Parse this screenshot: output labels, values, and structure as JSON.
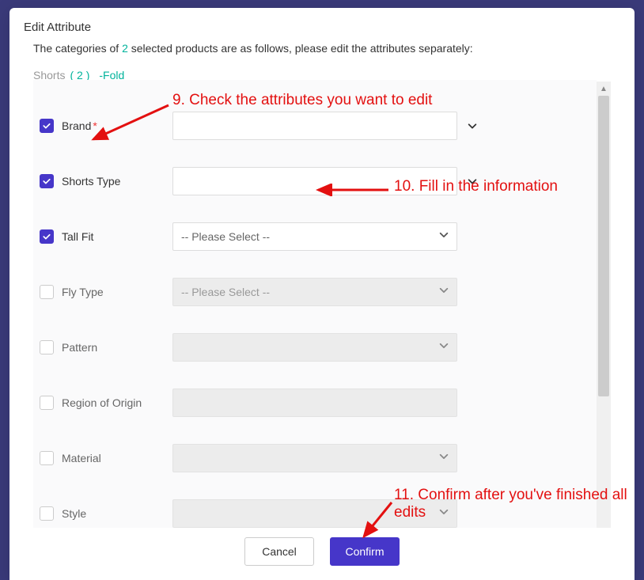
{
  "modal": {
    "title": "Edit Attribute",
    "intro_before": "The categories of ",
    "intro_count": "2",
    "intro_after": " selected products are as follows, please edit the attributes separately:",
    "tab_label": "Shorts",
    "tab_count": "( 2 )",
    "fold_label": "-Fold",
    "cancel_label": "Cancel",
    "confirm_label": "Confirm"
  },
  "select_placeholder": "-- Please Select --",
  "attributes": [
    {
      "label": "Brand",
      "checked": true,
      "required": true,
      "control": "input-dropdown",
      "value": ""
    },
    {
      "label": "Shorts Type",
      "checked": true,
      "required": false,
      "control": "input-dropdown",
      "value": ""
    },
    {
      "label": "Tall Fit",
      "checked": true,
      "required": false,
      "control": "select",
      "value": "-- Please Select --"
    },
    {
      "label": "Fly Type",
      "checked": false,
      "required": false,
      "control": "select-disabled",
      "value": "-- Please Select --"
    },
    {
      "label": "Pattern",
      "checked": false,
      "required": false,
      "control": "select-disabled",
      "value": ""
    },
    {
      "label": "Region of Origin",
      "checked": false,
      "required": false,
      "control": "input-disabled",
      "value": ""
    },
    {
      "label": "Material",
      "checked": false,
      "required": false,
      "control": "select-disabled",
      "value": ""
    },
    {
      "label": "Style",
      "checked": false,
      "required": false,
      "control": "select-disabled",
      "value": ""
    }
  ],
  "annotations": {
    "a9": "9. Check the attributes you want to edit",
    "a10": "10. Fill in the information",
    "a11": "11. Confirm after you've finished all edits"
  }
}
